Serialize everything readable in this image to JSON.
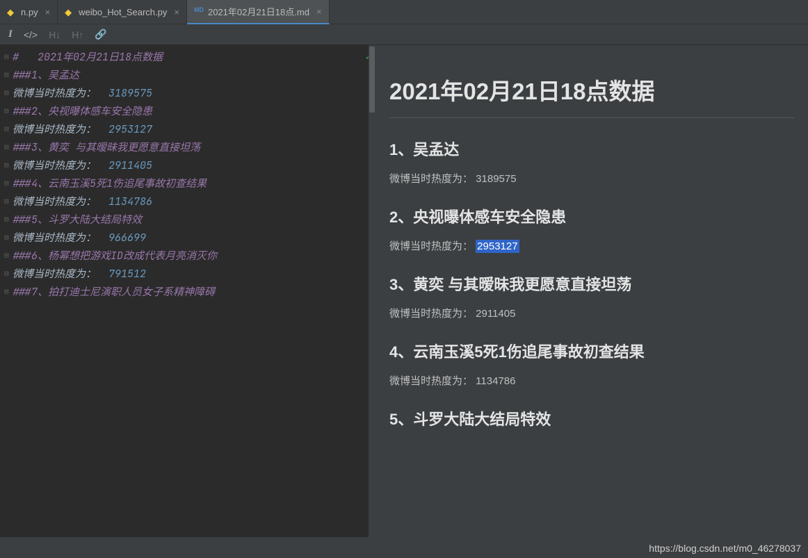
{
  "tabs": [
    {
      "label": "n.py",
      "type": "py",
      "active": false
    },
    {
      "label": "weibo_Hot_Search.py",
      "type": "py",
      "active": false
    },
    {
      "label": "2021年02月21日18点.md",
      "type": "md",
      "active": true
    }
  ],
  "toolbar": {
    "italic": "I",
    "code": "</>",
    "hdown": "H↓",
    "hup": "H↑",
    "link": "🔗"
  },
  "doc": {
    "title_prefix": "#",
    "title_text": "2021年02月21日18点数据",
    "heat_label_prefix": "微博当时热度为：",
    "h3_prefix": "###",
    "items": [
      {
        "rank": "1",
        "name": "吴孟达",
        "heat": "3189575"
      },
      {
        "rank": "2",
        "name": "央视曝体感车安全隐患",
        "heat": "2953127"
      },
      {
        "rank": "3",
        "name": "黄奕 与其暧昧我更愿意直接坦荡",
        "heat": "2911405"
      },
      {
        "rank": "4",
        "name": "云南玉溪5死1伤追尾事故初查结果",
        "heat": "1134786"
      },
      {
        "rank": "5",
        "name": "斗罗大陆大结局特效",
        "heat": "966699"
      },
      {
        "rank": "6",
        "name": "杨幂想把游戏ID改成代表月亮消灭你",
        "heat": "791512"
      },
      {
        "rank": "7",
        "name": "拍打迪士尼演职人员女子系精神障碍",
        "heat": ""
      }
    ]
  },
  "preview": {
    "title": "2021年02月21日18点数据",
    "heat_label": "微博当时热度为：",
    "items": [
      {
        "head": "1、吴孟达",
        "heat": "3189575",
        "selected": false
      },
      {
        "head": "2、央视曝体感车安全隐患",
        "heat": "2953127",
        "selected": true
      },
      {
        "head": "3、黄奕 与其暧昧我更愿意直接坦荡",
        "heat": "2911405",
        "selected": false
      },
      {
        "head": "4、云南玉溪5死1伤追尾事故初查结果",
        "heat": "1134786",
        "selected": false
      },
      {
        "head": "5、斗罗大陆大结局特效",
        "heat": "",
        "selected": false
      }
    ]
  },
  "watermark": "https://blog.csdn.net/m0_46278037"
}
